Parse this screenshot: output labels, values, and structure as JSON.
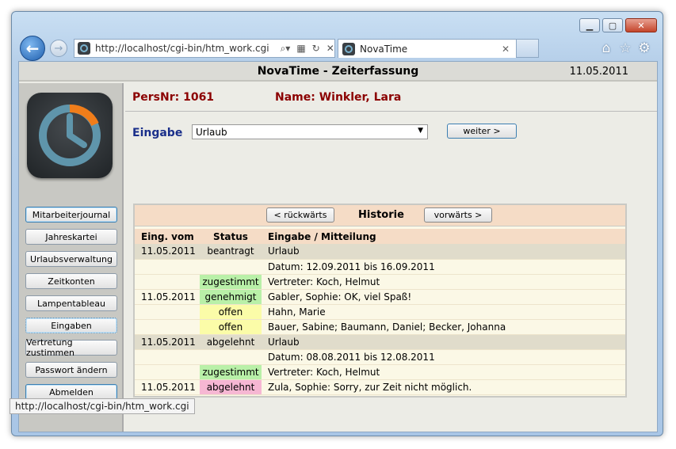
{
  "browser": {
    "url": "http://localhost/cgi-bin/htm_work.cgi",
    "tab_title": "NovaTime",
    "status_url": "http://localhost/cgi-bin/htm_work.cgi"
  },
  "app": {
    "title": "NovaTime - Zeiterfassung",
    "date": "11.05.2011"
  },
  "person": {
    "persnr": "PersNr: 1061",
    "name": "Name: Winkler, Lara"
  },
  "sidebar": {
    "items": [
      {
        "label": "Mitarbeiterjournal"
      },
      {
        "label": "Jahreskartei"
      },
      {
        "label": "Urlaubsverwaltung"
      },
      {
        "label": "Zeitkonten"
      },
      {
        "label": "Lampentableau"
      },
      {
        "label": "Eingaben"
      },
      {
        "label": "Vertretung zustimmen"
      },
      {
        "label": "Passwort ändern"
      },
      {
        "label": "Abmelden"
      }
    ]
  },
  "entry": {
    "label": "Eingabe",
    "selected": "Urlaub",
    "button": "weiter >"
  },
  "history": {
    "back_button": "< rückwärts",
    "title": "Historie",
    "forward_button": "vorwärts >",
    "columns": [
      "Eing. vom",
      "Status",
      "Eingabe / Mitteilung"
    ],
    "rows": [
      {
        "date": "11.05.2011",
        "status": "beantragt",
        "text": "Urlaub"
      },
      {
        "date": "",
        "status": "",
        "text": "Datum: 12.09.2011 bis 16.09.2011"
      },
      {
        "date": "",
        "status": "zugestimmt",
        "text": "Vertreter: Koch, Helmut"
      },
      {
        "date": "11.05.2011",
        "status": "genehmigt",
        "text": "Gabler, Sophie: OK, viel Spaß!"
      },
      {
        "date": "",
        "status": "offen",
        "text": "Hahn, Marie"
      },
      {
        "date": "",
        "status": "offen",
        "text": "Bauer, Sabine; Baumann, Daniel; Becker, Johanna"
      },
      {
        "date": "11.05.2011",
        "status": "abgelehnt",
        "text": "Urlaub"
      },
      {
        "date": "",
        "status": "",
        "text": "Datum: 08.08.2011 bis 12.08.2011"
      },
      {
        "date": "",
        "status": "zugestimmt",
        "text": "Vertreter: Koch, Helmut"
      },
      {
        "date": "11.05.2011",
        "status": "abgelehnt",
        "text": "Zula, Sophie: Sorry, zur Zeit nicht möglich."
      }
    ]
  },
  "colors": {
    "heading_red": "#8b0000",
    "label_blue": "#1a2f8a",
    "green": "#b9f0a8",
    "yellow": "#fbfca8",
    "pink": "#f6b7d3",
    "header_peach": "#f5dcc6"
  }
}
